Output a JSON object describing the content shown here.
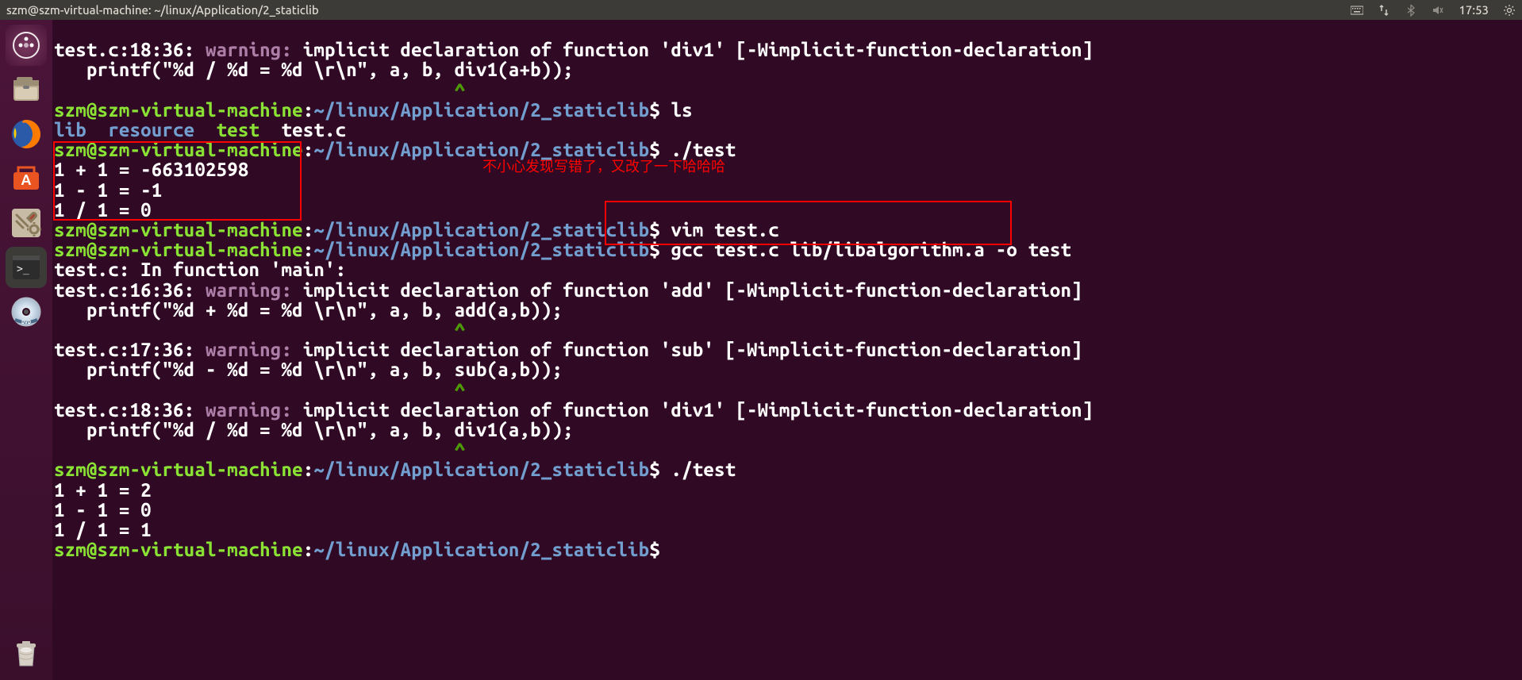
{
  "titlebar": {
    "title": "szm@szm-virtual-machine: ~/linux/Application/2_staticlib",
    "time": "17:53"
  },
  "prompt": {
    "user_host": "szm@szm-virtual-machine",
    "colon": ":",
    "path": "~/linux/Application/2_staticlib",
    "dollar": "$"
  },
  "term": {
    "w1_loc": "test.c:18:36:",
    "w1_tag": " warning: ",
    "w1_msg_a": "implicit declaration of function '",
    "w1_fn": "div1",
    "w1_msg_b": "' [-Wimplicit-function-declaration]",
    "w1_code": "   printf(\"%d / %d = %d \\r\\n\", a, b, div1(a+b));",
    "w1_caret": "                                     ^",
    "cmd_ls": " ls",
    "ls_out_a": "lib",
    "ls_out_b": "resource",
    "ls_out_c": "test",
    "ls_out_d": "test.c",
    "cmd_test": " ./test",
    "run1_l1": "1 + 1 = -663102598",
    "run1_l2": "1 - 1 = -1",
    "run1_l3": "1 / 1 = 0",
    "cmd_vim": " vim test.c",
    "cmd_gcc": " gcc test.c lib/libalgorithm.a -o test",
    "infunc_a": "test.c:",
    "infunc_b": " In function '",
    "infunc_c": "main",
    "infunc_d": "':",
    "w2_loc": "test.c:16:36:",
    "w2_tag": " warning: ",
    "w2_msg_a": "implicit declaration of function '",
    "w2_fn": "add",
    "w2_msg_b": "' [-Wimplicit-function-declaration]",
    "w2_code": "   printf(\"%d + %d = %d \\r\\n\", a, b, add(a,b));",
    "w2_caret": "                                     ^",
    "w3_loc": "test.c:17:36:",
    "w3_tag": " warning: ",
    "w3_msg_a": "implicit declaration of function '",
    "w3_fn": "sub",
    "w3_msg_b": "' [-Wimplicit-function-declaration]",
    "w3_code": "   printf(\"%d - %d = %d \\r\\n\", a, b, sub(a,b));",
    "w3_caret": "                                     ^",
    "w4_loc": "test.c:18:36:",
    "w4_tag": " warning: ",
    "w4_msg_a": "implicit declaration of function '",
    "w4_fn": "div1",
    "w4_msg_b": "' [-Wimplicit-function-declaration]",
    "w4_code": "   printf(\"%d / %d = %d \\r\\n\", a, b, div1(a,b));",
    "w4_caret": "                                     ^",
    "cmd_test2": " ./test",
    "run2_l1": "1 + 1 = 2",
    "run2_l2": "1 - 1 = 0",
    "run2_l3": "1 / 1 = 1",
    "empty": " "
  },
  "annotation": {
    "text": "不小心发现写错了，又改了一下哈哈哈"
  }
}
